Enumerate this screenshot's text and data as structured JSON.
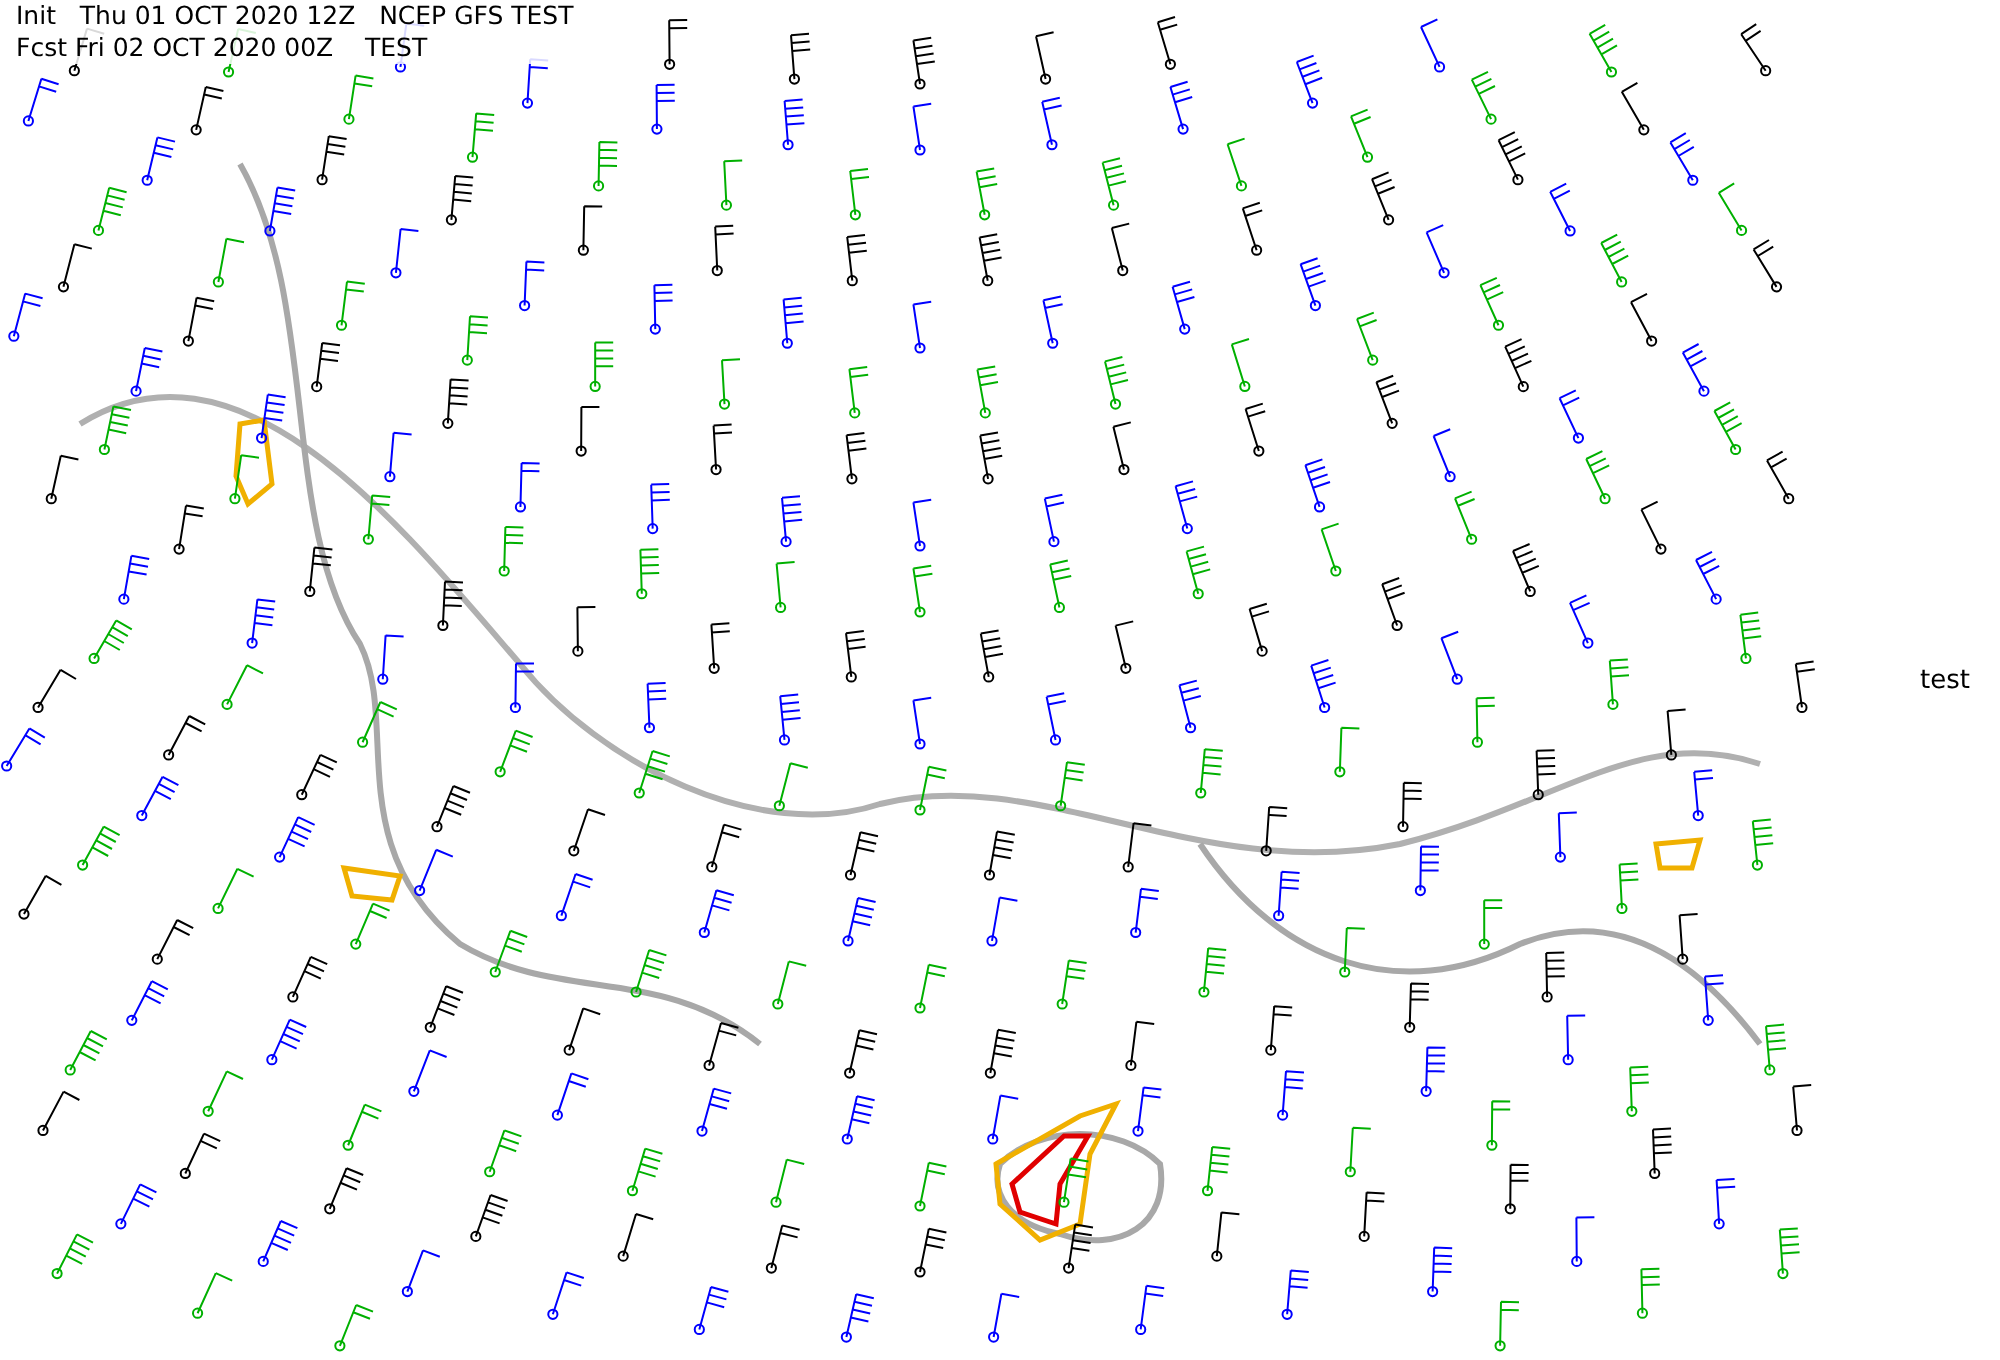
{
  "header": {
    "lines": [
      "Init   Thu 01 OCT 2020 12Z   NCEP GFS TEST",
      "Fcst Fri 02 OCT 2020 00Z    TEST"
    ]
  },
  "side_label": "test"
}
